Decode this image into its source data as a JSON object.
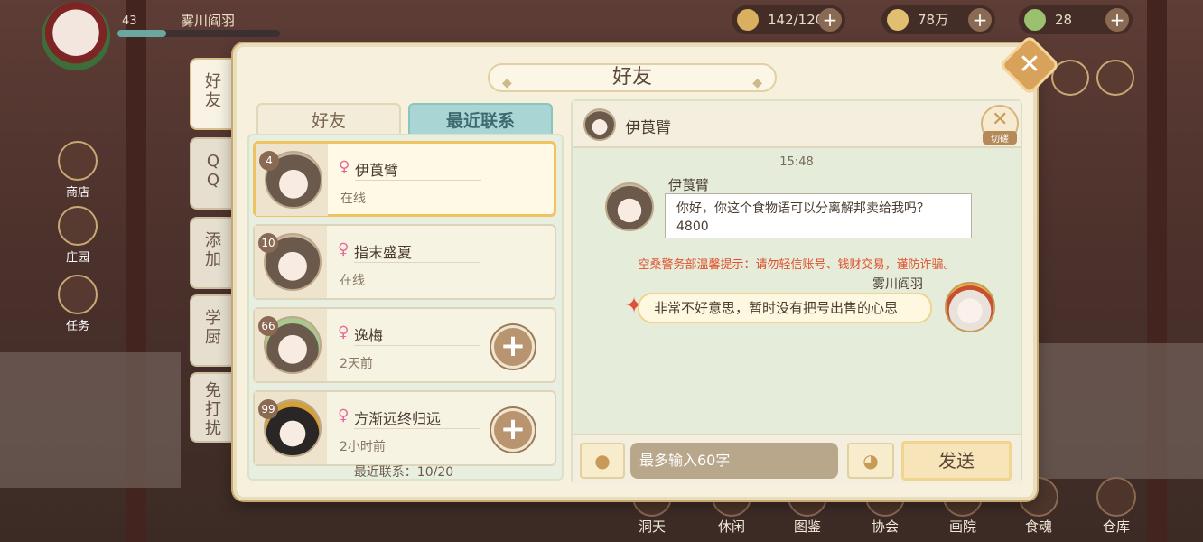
{
  "hud": {
    "level": "43",
    "player_name": "雾川阎羽",
    "res1": "142/120",
    "res2": "78万",
    "res3": "28"
  },
  "left_menu": [
    "商店",
    "庄园",
    "任务"
  ],
  "bottom_nav": [
    "洞天",
    "休闲",
    "图鉴",
    "协会",
    "画院",
    "食魂",
    "仓库"
  ],
  "side_tabs": [
    "好\n友",
    "Q\nQ",
    "添\n加",
    "学\n厨",
    "免\n打\n扰"
  ],
  "panel": {
    "title": "好友",
    "close_symbol": "✕"
  },
  "list_tabs": {
    "friends": "好友",
    "recent": "最近联系"
  },
  "contacts": [
    {
      "level": "4",
      "gender": "♀",
      "name": "伊莨臂",
      "status": "在线",
      "selected": true,
      "add": false
    },
    {
      "level": "10",
      "gender": "♀",
      "name": "指末盛夏",
      "status": "在线",
      "selected": false,
      "add": false
    },
    {
      "level": "66",
      "gender": "♀",
      "name": "逸梅",
      "status": "2天前",
      "selected": false,
      "add": true
    },
    {
      "level": "99",
      "gender": "♀",
      "name": "方渐远终归远",
      "status": "2小时前",
      "selected": false,
      "add": true
    }
  ],
  "recent_count": "最近联系：10/20",
  "chat": {
    "header_name": "伊莨臂",
    "cut_label": "切磋",
    "time": "15:48",
    "sender_name": "伊莨臂",
    "incoming": "你好，你这个食物语可以分离解邦卖给我吗？4800",
    "warning": "空桑警务部温馨提示：请勿轻信账号、钱财交易，谨防诈骗。",
    "my_name": "雾川阎羽",
    "outgoing": "非常不好意思，暂时没有把号出售的心思",
    "input_placeholder": "最多输入60字",
    "send_label": "发送"
  },
  "icons": {
    "mic": "microphone-icon",
    "emoji": "cat-emoji-icon",
    "add": "plus-icon",
    "close": "close-icon"
  }
}
